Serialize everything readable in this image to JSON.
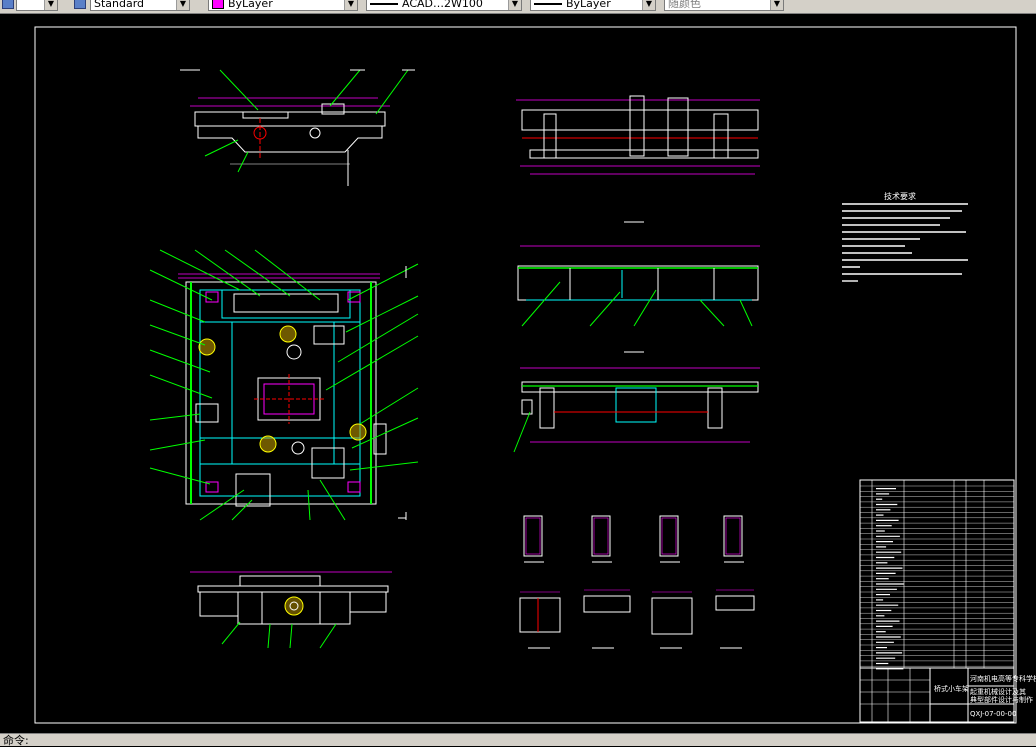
{
  "toolbar": {
    "text_style": "Standard",
    "layer": "ByLayer",
    "linetype": "ACAD…2W100",
    "lineweight": "ByLayer",
    "plot_style": "随颜色"
  },
  "status": {
    "command_prompt": "命令:"
  },
  "drawing": {
    "tech_req_title": "技术要求",
    "title_block": {
      "drawing_name": "桥式小车架",
      "school_line1": "河南机电高等专科学校",
      "school_line2": "起重机械设计及其",
      "school_line3": "典型部件设计与制作",
      "drawing_no": "QXJ-07-00-00"
    },
    "colors": {
      "background": "#000000",
      "outline": "#ffffff",
      "dimension": "#ff00ff",
      "leader": "#00ff00",
      "hidden": "#00ffff",
      "centerline": "#ff0000",
      "hatch": "#ffff00"
    }
  }
}
